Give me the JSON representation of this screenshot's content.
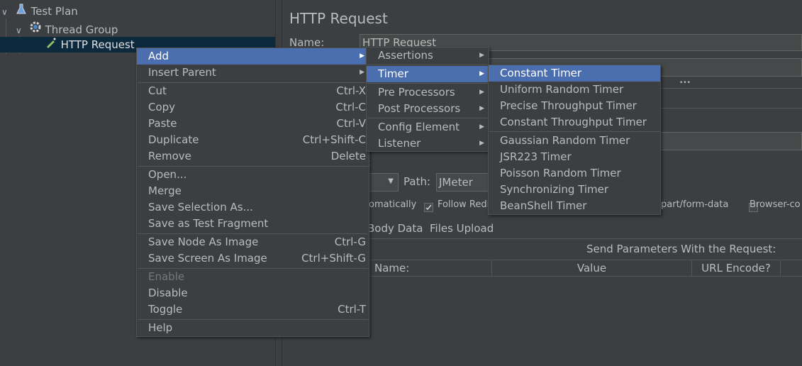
{
  "tree": {
    "items": [
      {
        "label": "Test Plan",
        "icon": "flask-icon"
      },
      {
        "label": "Thread Group",
        "icon": "gear-icon"
      },
      {
        "label": "HTTP Request",
        "icon": "pipette-icon"
      }
    ]
  },
  "panel": {
    "title": "HTTP Request",
    "name_label": "Name:",
    "name_value": "HTTP Request",
    "path_label": "Path:",
    "path_value": "JMeter",
    "opt_follow": "Follow Redi",
    "opt_auto": "omatically",
    "opt_multipart": "part/form-data",
    "opt_browser": "Browser-co",
    "tabs": [
      "Body Data",
      "Files Upload"
    ],
    "send_params": "Send Parameters With the Request:",
    "columns": [
      "Name:",
      "Value",
      "URL Encode?"
    ],
    "ellipsis": "•••",
    "stub_colon": ":"
  },
  "context_menu": {
    "items": [
      {
        "label": "Add",
        "shortcut": "",
        "submenu": true
      },
      {
        "label": "Insert Parent",
        "shortcut": "",
        "submenu": true
      },
      {
        "label": "Cut",
        "shortcut": "Ctrl-X"
      },
      {
        "label": "Copy",
        "shortcut": "Ctrl-C"
      },
      {
        "label": "Paste",
        "shortcut": "Ctrl-V"
      },
      {
        "label": "Duplicate",
        "shortcut": "Ctrl+Shift-C"
      },
      {
        "label": "Remove",
        "shortcut": "Delete"
      },
      {
        "label": "Open...",
        "shortcut": ""
      },
      {
        "label": "Merge",
        "shortcut": ""
      },
      {
        "label": "Save Selection As...",
        "shortcut": ""
      },
      {
        "label": "Save as Test Fragment",
        "shortcut": ""
      },
      {
        "label": "Save Node As Image",
        "shortcut": "Ctrl-G"
      },
      {
        "label": "Save Screen As Image",
        "shortcut": "Ctrl+Shift-G"
      },
      {
        "label": "Enable",
        "shortcut": ""
      },
      {
        "label": "Disable",
        "shortcut": ""
      },
      {
        "label": "Toggle",
        "shortcut": "Ctrl-T"
      },
      {
        "label": "Help",
        "shortcut": ""
      }
    ]
  },
  "add_submenu": {
    "items": [
      "Assertions",
      "Timer",
      "Pre Processors",
      "Post Processors",
      "Config Element",
      "Listener"
    ]
  },
  "timer_submenu": {
    "items": [
      "Constant Timer",
      "Uniform Random Timer",
      "Precise Throughput Timer",
      "Constant Throughput Timer",
      "Gaussian Random Timer",
      "JSR223 Timer",
      "Poisson Random Timer",
      "Synchronizing Timer",
      "BeanShell Timer"
    ]
  },
  "colors": {
    "highlight": "#4b6eaf",
    "background": "#3c3f41",
    "selection": "#0d293e"
  }
}
